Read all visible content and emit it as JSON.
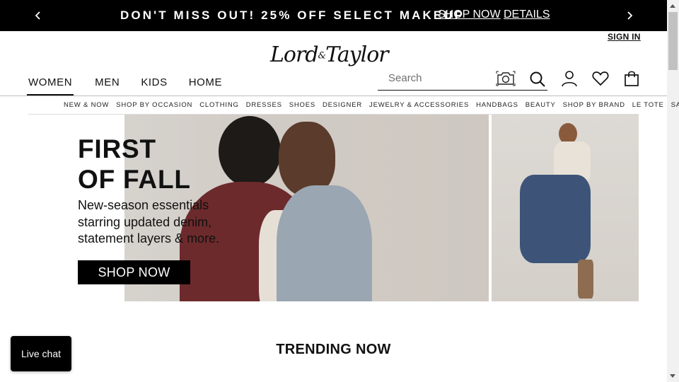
{
  "promo": {
    "message": "DON'T MISS OUT! 25% OFF SELECT MAKEUP",
    "shop_now": "SHOP NOW",
    "details": "DETAILS"
  },
  "header": {
    "sign_in": "SIGN IN",
    "logo_main": "Lord",
    "logo_amp": "&",
    "logo_tail": "Taylor",
    "search_placeholder": "Search"
  },
  "main_nav": [
    "WOMEN",
    "MEN",
    "KIDS",
    "HOME"
  ],
  "sub_nav": [
    "NEW & NOW",
    "SHOP BY OCCASION",
    "CLOTHING",
    "DRESSES",
    "SHOES",
    "DESIGNER",
    "JEWELRY & ACCESSORIES",
    "HANDBAGS",
    "BEAUTY",
    "SHOP BY BRAND",
    "LE TOTE",
    "SALE"
  ],
  "hero": {
    "title_line1": "FIRST",
    "title_line2": "OF FALL",
    "subtitle": "New-season essentials starring updated denim, statement layers & more.",
    "button": "SHOP NOW"
  },
  "trending": "TRENDING NOW",
  "live_chat": "Live chat",
  "icons": [
    "chevron-left-icon",
    "chevron-right-icon",
    "camera-icon",
    "search-icon",
    "user-icon",
    "heart-icon",
    "shopping-bag-icon"
  ]
}
